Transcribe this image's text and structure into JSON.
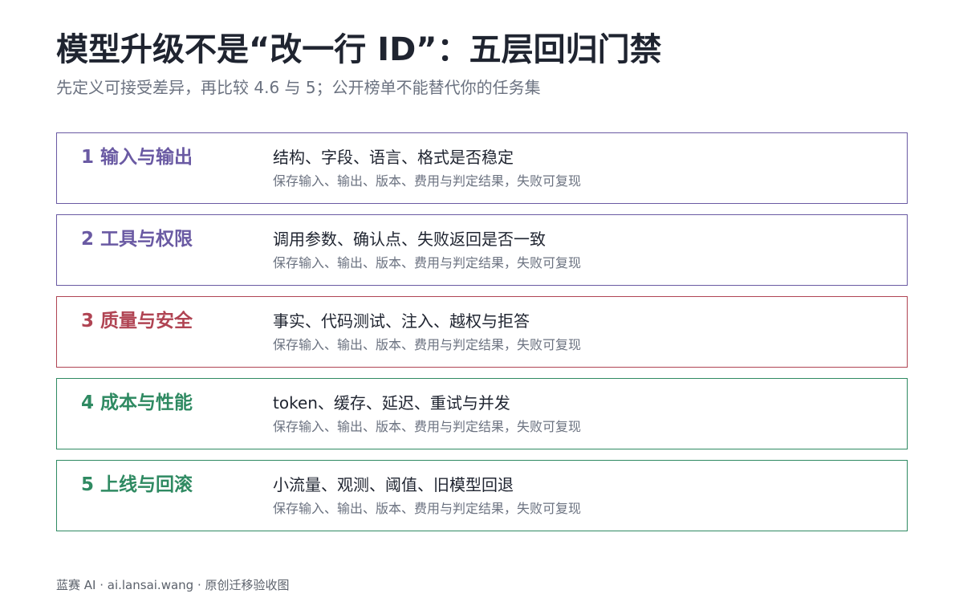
{
  "title": "模型升级不是“改一行 ID”：五层回归门禁",
  "subtitle": "先定义可接受差异，再比较 4.6 与 5；公开榜单不能替代你的任务集",
  "layers": [
    {
      "label": "1 输入与输出",
      "description": "结构、字段、语言、格式是否稳定",
      "note": "保存输入、输出、版本、费用与判定结果，失败可复现",
      "color": "#6a5aa3"
    },
    {
      "label": "2 工具与权限",
      "description": "调用参数、确认点、失败返回是否一致",
      "note": "保存输入、输出、版本、费用与判定结果，失败可复现",
      "color": "#6a5aa3"
    },
    {
      "label": "3 质量与安全",
      "description": "事实、代码测试、注入、越权与拒答",
      "note": "保存输入、输出、版本、费用与判定结果，失败可复现",
      "color": "#b04453"
    },
    {
      "label": "4 成本与性能",
      "description": "token、缓存、延迟、重试与并发",
      "note": "保存输入、输出、版本、费用与判定结果，失败可复现",
      "color": "#2f8a62"
    },
    {
      "label": "5 上线与回滚",
      "description": "小流量、观测、阈值、旧模型回退",
      "note": "保存输入、输出、版本、费用与判定结果，失败可复现",
      "color": "#2f8a62"
    }
  ],
  "footer": "蓝赛 AI · ai.lansai.wang · 原创迁移验收图"
}
